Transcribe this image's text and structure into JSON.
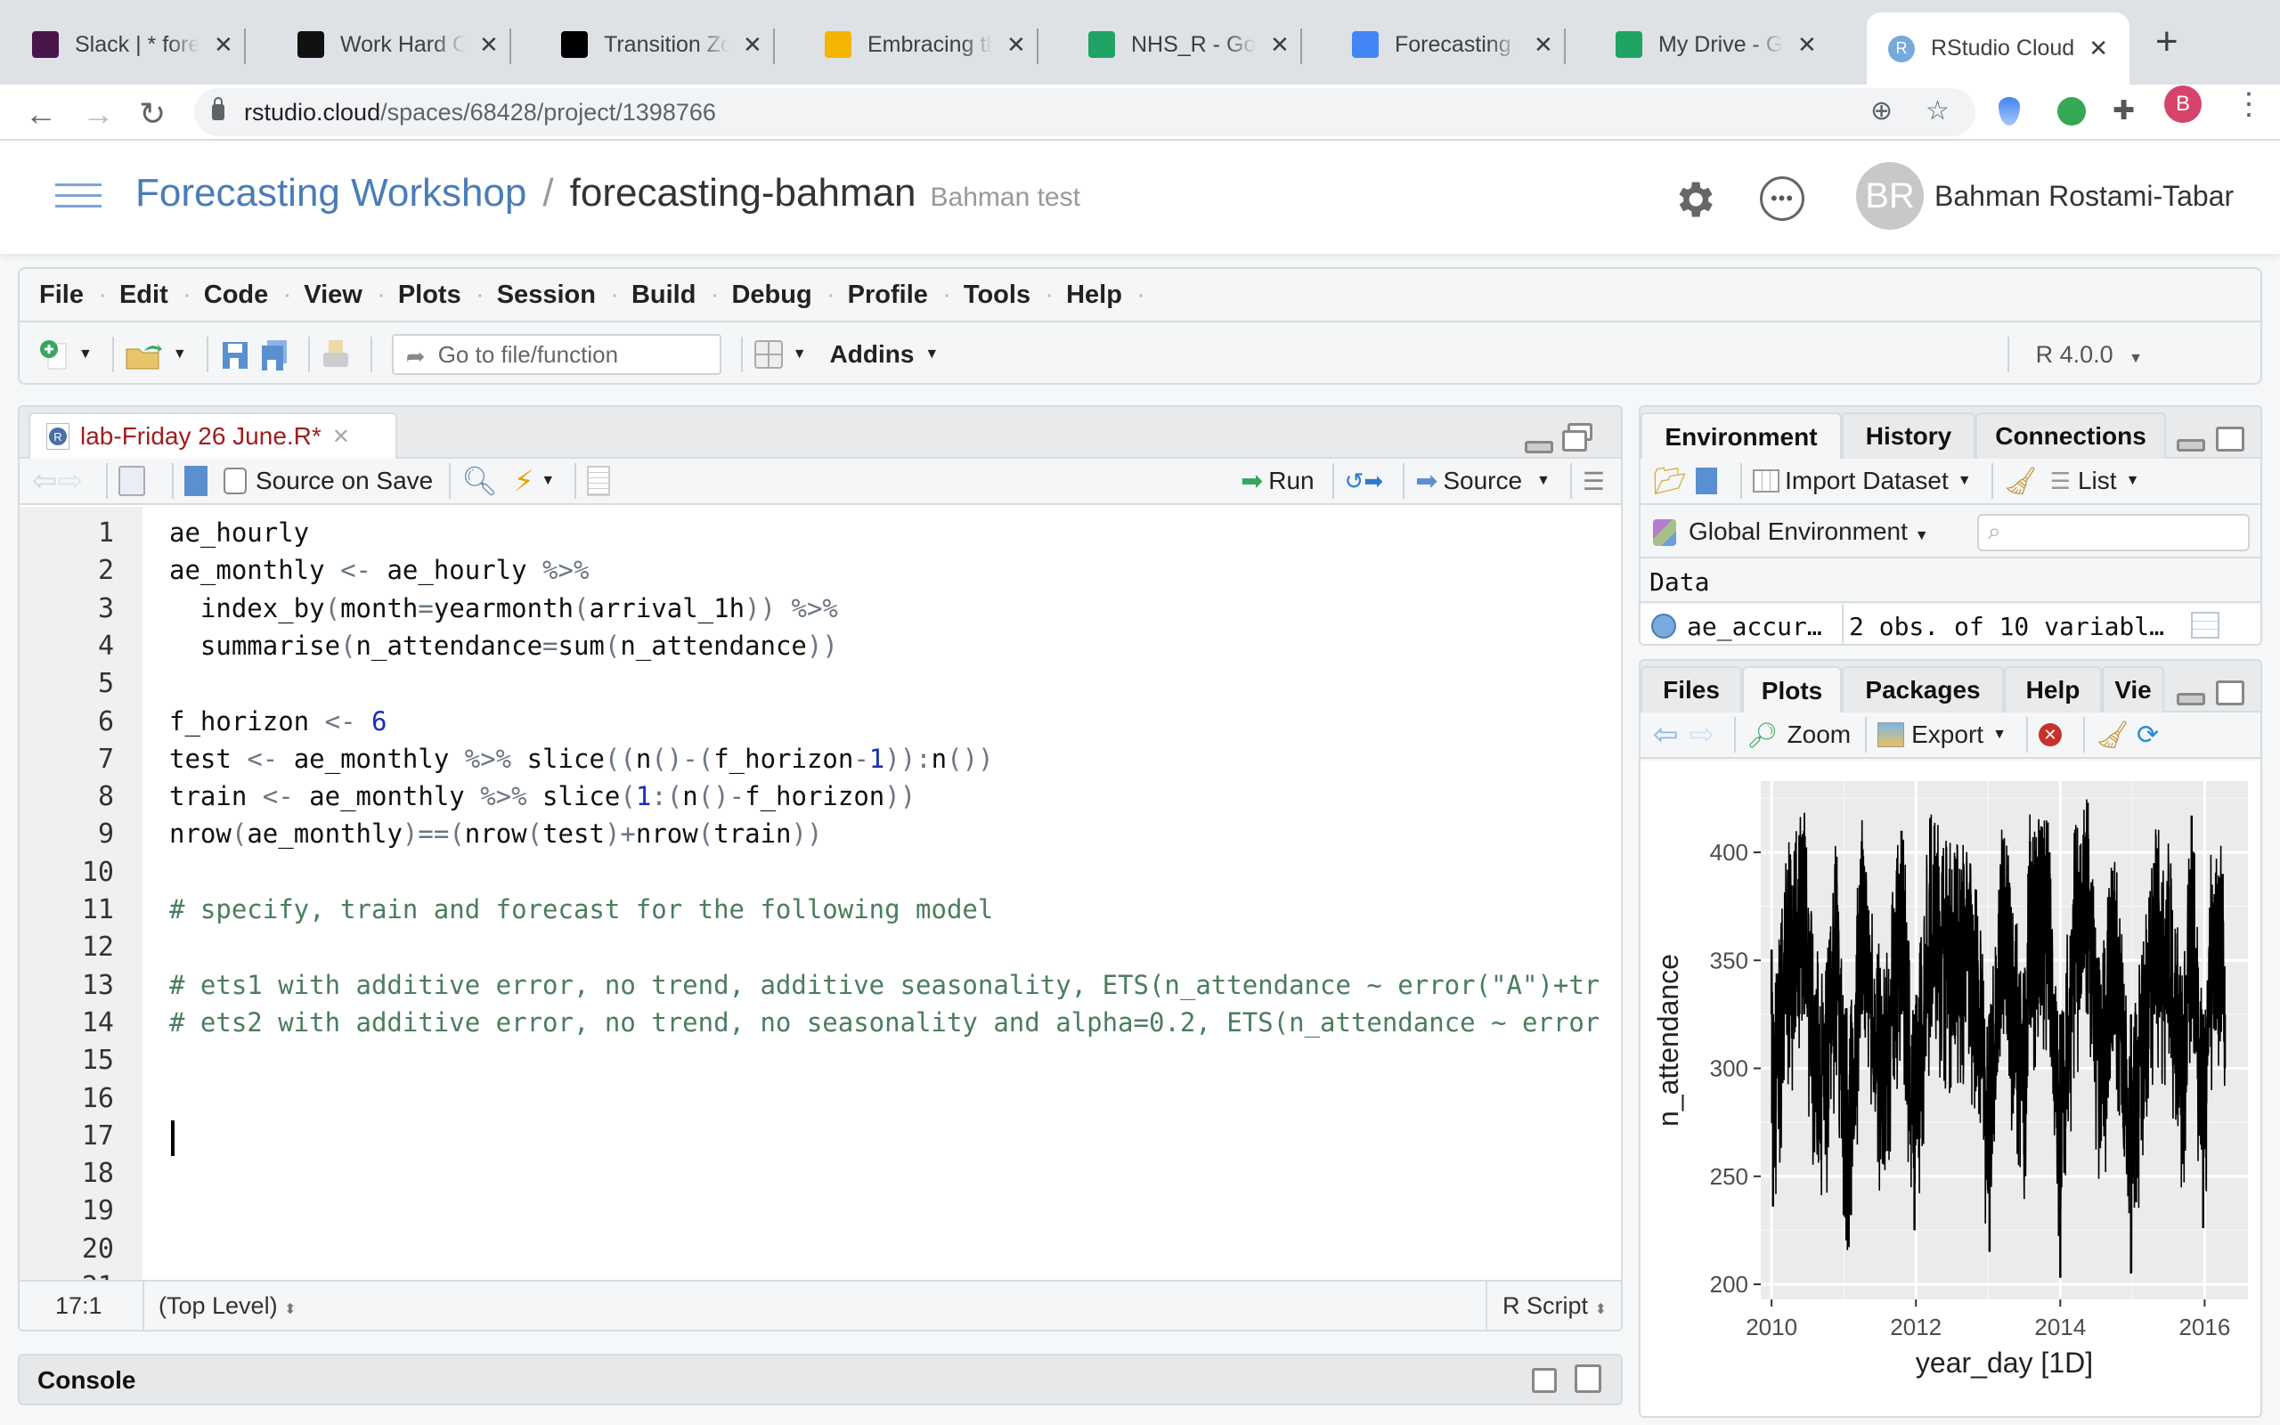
{
  "browser": {
    "tabs": [
      {
        "title": "Slack | * forecasting",
        "icon": "slack-icon",
        "color": "#4a154b"
      },
      {
        "title": "Work Hard GIF",
        "icon": "giphy-icon",
        "color": "#111111"
      },
      {
        "title": "Transition Zone",
        "icon": "unsplash-icon",
        "color": "#000000"
      },
      {
        "title": "Embracing the",
        "icon": "slides-icon",
        "color": "#f4b400"
      },
      {
        "title": "NHS_R - Google Drive",
        "icon": "drive-icon",
        "color": "#1fa463"
      },
      {
        "title": "Forecasting and",
        "icon": "docs-icon",
        "color": "#4285f4"
      },
      {
        "title": "My Drive - Google Drive",
        "icon": "drive-icon",
        "color": "#1fa463"
      },
      {
        "title": "RStudio Cloud",
        "icon": "rstudio-icon",
        "color": "#75aadb",
        "active": true
      }
    ],
    "new_tab": "+",
    "url_host": "rstudio.cloud",
    "url_path": "/spaces/68428/project/1398766",
    "profile_initial": "B"
  },
  "cloud_header": {
    "space": "Forecasting Workshop",
    "separator": "/",
    "project": "forecasting-bahman",
    "project_desc": "Bahman test",
    "user_initials": "BR",
    "user_name": "Bahman Rostami-Tabar"
  },
  "menu": [
    "File",
    "Edit",
    "Code",
    "View",
    "Plots",
    "Session",
    "Build",
    "Debug",
    "Profile",
    "Tools",
    "Help"
  ],
  "toolbar": {
    "goto_placeholder": "Go to file/function",
    "addins": "Addins",
    "r_version": "R 4.0.0"
  },
  "editor": {
    "tab_title": "lab-Friday 26 June.R*",
    "source_on_save": "Source on Save",
    "run": "Run",
    "source": "Source",
    "lines": [
      "ae_hourly",
      "ae_monthly <- ae_hourly %>%",
      "  index_by(month=yearmonth(arrival_1h)) %>%",
      "  summarise(n_attendance=sum(n_attendance))",
      "",
      "f_horizon <- 6",
      "test <- ae_monthly %>% slice((n()-(f_horizon-1)):n())",
      "train <- ae_monthly %>% slice(1:(n()-f_horizon))",
      "nrow(ae_monthly)==(nrow(test)+nrow(train))",
      "",
      "# specify, train and forecast for the following model",
      "",
      "# ets1 with additive error, no trend, additive seasonality, ETS(n_attendance ~ error(\"A\")+tr",
      "# ets2 with additive error, no trend, no seasonality and alpha=0.2, ETS(n_attendance ~ error",
      "",
      "",
      "",
      "",
      "",
      "",
      ""
    ],
    "line_count": 21,
    "cursor_line": 17,
    "cursor_position": "17:1",
    "scope": "(Top Level)",
    "file_type": "R Script"
  },
  "console": {
    "title": "Console"
  },
  "env_pane": {
    "tabs": [
      "Environment",
      "History",
      "Connections"
    ],
    "active_tab": "Environment",
    "import_dataset": "Import Dataset",
    "list_view": "List",
    "scope": "Global Environment",
    "search_placeholder": "",
    "section": "Data",
    "rows": [
      {
        "name": "ae_accur…",
        "value": "2 obs. of 10 variabl…"
      }
    ]
  },
  "files_pane": {
    "tabs": [
      "Files",
      "Plots",
      "Packages",
      "Help",
      "Vie"
    ],
    "active_tab": "Plots",
    "zoom": "Zoom",
    "export": "Export"
  },
  "chart_data": {
    "type": "line",
    "title": "",
    "xlabel": "year_day [1D]",
    "ylabel": "n_attendance",
    "x_ticks": [
      "2010",
      "2012",
      "2014",
      "2016"
    ],
    "y_ticks": [
      "200",
      "250",
      "300",
      "350",
      "400"
    ],
    "xlim": [
      2009.85,
      2016.6
    ],
    "ylim": [
      193,
      433
    ],
    "grid": true,
    "legend": "none",
    "description": "Daily A&E attendance 2010-01 to 2016-04, oscillating mostly between ~260 and ~400 with mean ~325, annual dips near each new year",
    "series": [
      {
        "name": "n_attendance",
        "sample_points": [
          [
            2010.0,
            355
          ],
          [
            2010.02,
            236
          ],
          [
            2010.2,
            372
          ],
          [
            2010.45,
            410
          ],
          [
            2010.6,
            288
          ],
          [
            2010.75,
            260
          ],
          [
            2010.9,
            398
          ],
          [
            2011.0,
            232
          ],
          [
            2011.1,
            232
          ],
          [
            2011.25,
            405
          ],
          [
            2011.55,
            258
          ],
          [
            2011.8,
            410
          ],
          [
            2011.98,
            225
          ],
          [
            2012.2,
            416
          ],
          [
            2012.45,
            380
          ],
          [
            2012.75,
            386
          ],
          [
            2012.9,
            300
          ],
          [
            2013.02,
            215
          ],
          [
            2013.2,
            406
          ],
          [
            2013.5,
            260
          ],
          [
            2013.58,
            405
          ],
          [
            2013.85,
            400
          ],
          [
            2014.0,
            203
          ],
          [
            2014.2,
            396
          ],
          [
            2014.38,
            423
          ],
          [
            2014.55,
            263
          ],
          [
            2014.75,
            382
          ],
          [
            2014.98,
            205
          ],
          [
            2015.05,
            238
          ],
          [
            2015.3,
            395
          ],
          [
            2015.5,
            384
          ],
          [
            2015.7,
            256
          ],
          [
            2015.82,
            417
          ],
          [
            2015.98,
            226
          ],
          [
            2016.1,
            385
          ],
          [
            2016.25,
            390
          ],
          [
            2016.28,
            300
          ]
        ]
      }
    ]
  }
}
